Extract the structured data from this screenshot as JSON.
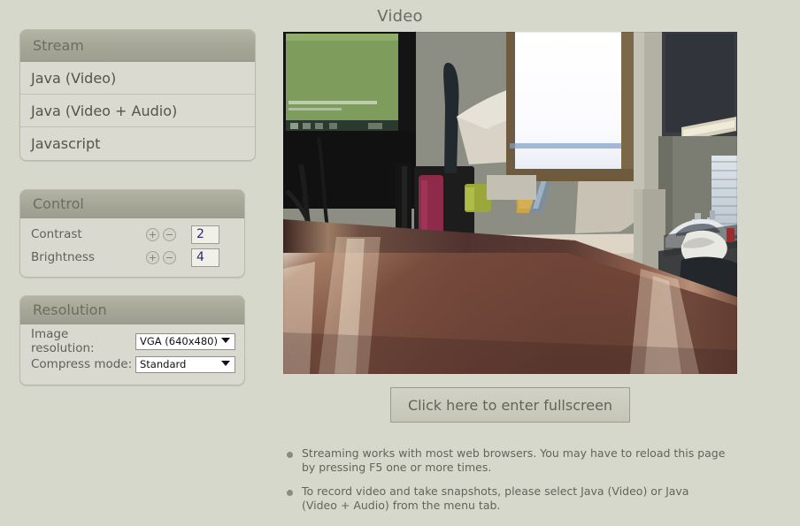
{
  "page": {
    "title": "Video"
  },
  "stream_panel": {
    "header": "Stream",
    "items": [
      {
        "label": "Java (Video)"
      },
      {
        "label": "Java (Video + Audio)"
      },
      {
        "label": "Javascript"
      }
    ]
  },
  "control_panel": {
    "header": "Control",
    "rows": [
      {
        "label": "Contrast",
        "value": "2",
        "plus": "+",
        "minus": "−"
      },
      {
        "label": "Brightness",
        "value": "4",
        "plus": "+",
        "minus": "−"
      }
    ]
  },
  "resolution_panel": {
    "header": "Resolution",
    "image_resolution": {
      "label": "Image resolution:",
      "value": "VGA (640x480)"
    },
    "compress_mode": {
      "label": "Compress mode:",
      "value": "Standard"
    }
  },
  "video": {
    "alt": "live webcam view of an office desk with a window, CCTV box, pen holder and a model car on a shelf"
  },
  "fullscreen_button": {
    "label": "Click here to enter fullscreen"
  },
  "notes": [
    {
      "text": "Streaming works with most web browsers. You may have to reload this page by pressing F5 one or more times."
    },
    {
      "text": "To record video and take snapshots, please select Java (Video) or Java (Video + Audio) from the menu tab."
    }
  ],
  "colors": {
    "page_background": "#d7d8cc",
    "panel_header": "#a6a697",
    "panel_body": "#dcdcd2",
    "panel_border": "#b9b9ac",
    "text": "#60605a",
    "input_text": "#2a2a7a"
  }
}
